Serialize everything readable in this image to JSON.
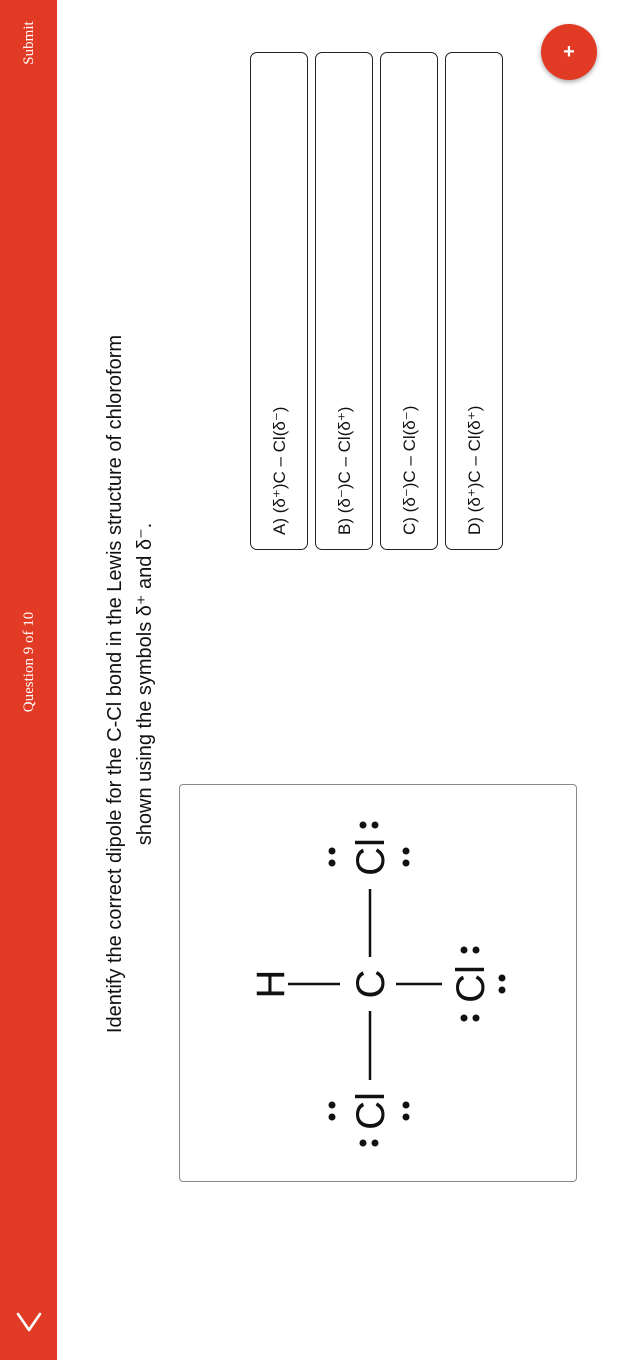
{
  "header": {
    "submit_label": "Submit",
    "progress_label": "Question 9 of 10",
    "back_icon": "chevron-icon"
  },
  "question": {
    "line1": "Identify the correct dipole for the C-Cl bond in the Lewis structure of chloroform",
    "line2": "shown using the symbols δ⁺ and δ⁻."
  },
  "molecule": {
    "center": "C",
    "top": "H",
    "left": "Cl",
    "right": "Cl",
    "bottom": "Cl"
  },
  "options": [
    {
      "label": "A) (δ⁺)C – Cl(δ⁻)"
    },
    {
      "label": "B) (δ⁻)C – Cl(δ⁺)"
    },
    {
      "label": "C) (δ⁻)C – Cl(δ⁻)"
    },
    {
      "label": "D) (δ⁺)C – Cl(δ⁺)"
    }
  ],
  "fab": {
    "label": "+",
    "icon": "plus-icon"
  },
  "colors": {
    "accent": "#e13b25",
    "border": "#222222"
  }
}
